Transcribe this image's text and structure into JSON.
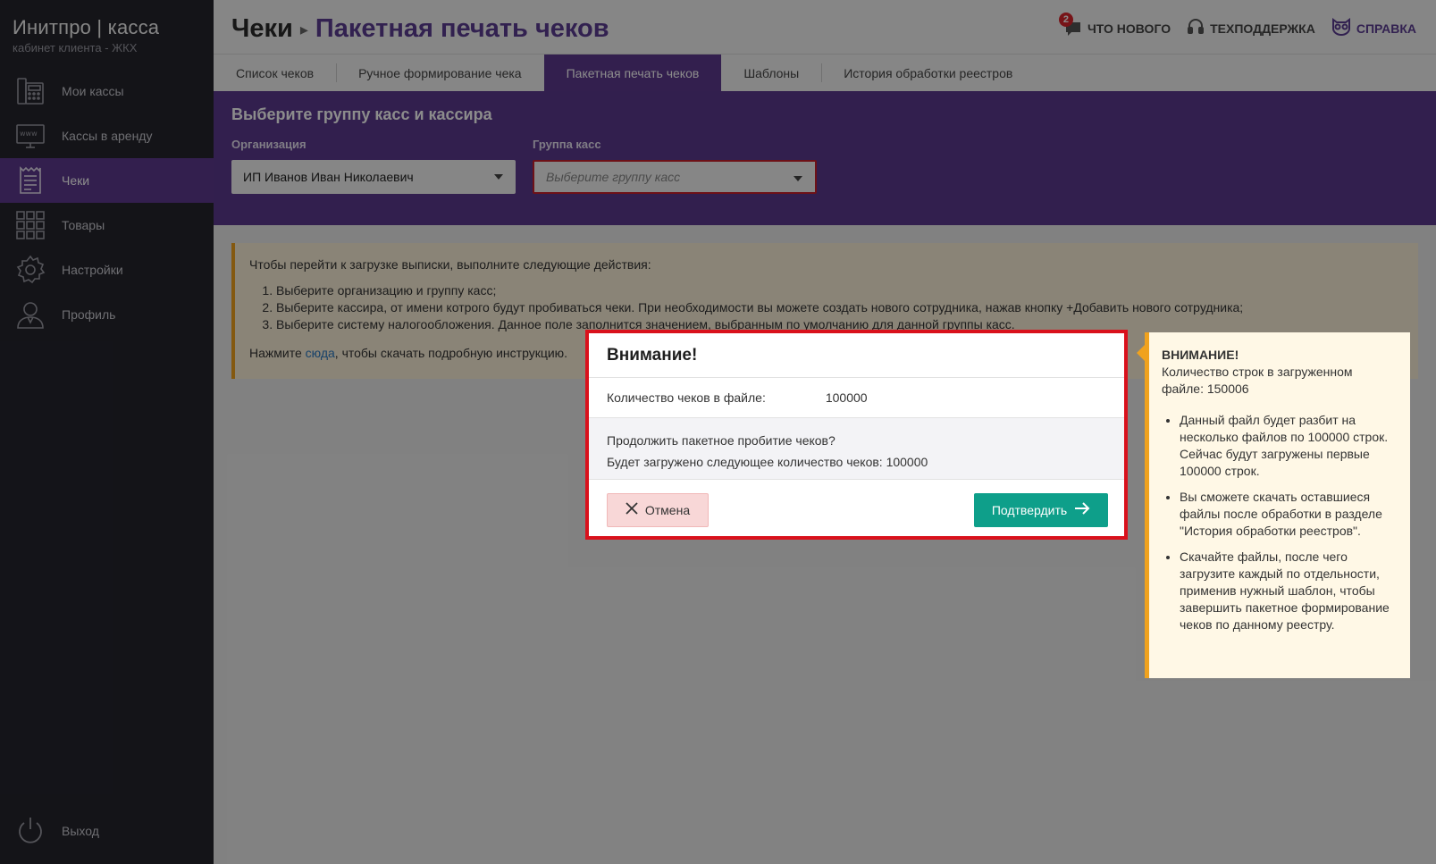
{
  "brand": {
    "title": "Инитпро | касса",
    "subtitle": "кабинет клиента - ЖКХ"
  },
  "sidebar": {
    "items": [
      {
        "label": "Мои кассы",
        "icon": "cash-register-icon"
      },
      {
        "label": "Кассы в аренду",
        "icon": "www-monitor-icon"
      },
      {
        "label": "Чеки",
        "icon": "receipt-icon"
      },
      {
        "label": "Товары",
        "icon": "grid-icon"
      },
      {
        "label": "Настройки",
        "icon": "gear-icon"
      },
      {
        "label": "Профиль",
        "icon": "user-icon"
      }
    ],
    "logout": "Выход"
  },
  "header": {
    "crumb": "Чеки",
    "current": "Пакетная печать чеков",
    "whats_new": "ЧТО НОВОГО",
    "whats_new_badge": "2",
    "support": "ТЕХПОДДЕРЖКА",
    "help": "СПРАВКА"
  },
  "tabs": [
    {
      "label": "Список чеков"
    },
    {
      "label": "Ручное формирование чека"
    },
    {
      "label": "Пакетная печать чеков"
    },
    {
      "label": "Шаблоны"
    },
    {
      "label": "История обработки реестров"
    }
  ],
  "panel": {
    "title": "Выберите группу касс и кассира",
    "org_label": "Организация",
    "org_value": "ИП Иванов Иван Николаевич",
    "group_label": "Группа касс",
    "group_placeholder": "Выберите группу касс"
  },
  "info": {
    "intro": "Чтобы перейти к загрузке выписки, выполните следующие действия:",
    "steps": [
      "Выберите организацию и группу касс;",
      "Выберите кассира, от имени котрого будут пробиваться чеки. При необходимости вы можете создать нового сотрудника, нажав кнопку +Добавить нового сотрудника;",
      "Выберите систему налогообложения. Данное поле заполнится значением, выбранным по умолчанию для данной группы касс."
    ],
    "hint_before": "Нажмите ",
    "hint_link": "сюда",
    "hint_after": ", чтобы скачать подробную инструкцию."
  },
  "modal": {
    "title": "Внимание!",
    "count_label": "Количество чеков в файле:",
    "count_value": "100000",
    "question": "Продолжить пакетное пробитие чеков?",
    "will_load": "Будет загружено следующее количество чеков: 100000",
    "cancel": "Отмена",
    "confirm": "Подтвердить"
  },
  "warning": {
    "title": "ВНИМАНИЕ!",
    "subtitle": "Количество строк в загруженном файле: 150006",
    "items": [
      "Данный файл будет разбит на несколько файлов по 100000 строк. Сейчас будут загружены первые 100000 строк.",
      "Вы сможете скачать оставшиеся файлы после обработки в разделе \"История обработки реестров\".",
      "Скачайте файлы, после чего загрузите каждый по отдельности, применив нужный шаблон, чтобы завершить пакетное формирование чеков по данному реестру."
    ]
  },
  "colors": {
    "accent": "#5b3a8f",
    "confirm": "#0e9f8a",
    "warning": "#f0a21e",
    "error": "#d9111c"
  }
}
